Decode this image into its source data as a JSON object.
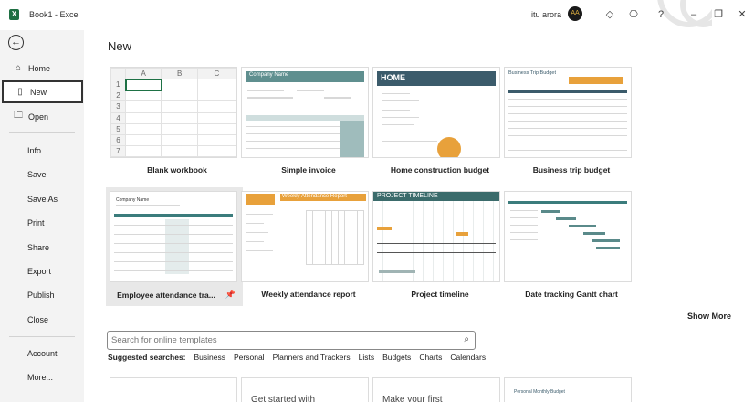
{
  "window": {
    "title": "Book1  -  Excel",
    "user_name": "itu arora",
    "avatar_initials": "AA"
  },
  "sidebar": {
    "items": [
      {
        "label": "Home",
        "icon": "home-icon"
      },
      {
        "label": "New",
        "icon": "new-file-icon"
      },
      {
        "label": "Open",
        "icon": "folder-open-icon"
      },
      {
        "label": "Info"
      },
      {
        "label": "Save"
      },
      {
        "label": "Save As"
      },
      {
        "label": "Print"
      },
      {
        "label": "Share"
      },
      {
        "label": "Export"
      },
      {
        "label": "Publish"
      },
      {
        "label": "Close"
      },
      {
        "label": "Account"
      },
      {
        "label": "More..."
      }
    ],
    "selected": "New"
  },
  "main": {
    "heading": "New",
    "templates_row1": [
      {
        "label": "Blank workbook"
      },
      {
        "label": "Simple invoice",
        "thumb_title": "Company Name"
      },
      {
        "label": "Home construction budget",
        "thumb_title": "HOME"
      },
      {
        "label": "Business trip budget",
        "thumb_title": "Business Trip Budget"
      }
    ],
    "templates_row2": [
      {
        "label": "Employee attendance tra...",
        "thumb_title": "Company Name"
      },
      {
        "label": "Weekly attendance report",
        "thumb_title": "Weekly Attendance Report"
      },
      {
        "label": "Project timeline",
        "thumb_title": "PROJECT TIMELINE"
      },
      {
        "label": "Date tracking Gantt chart"
      }
    ],
    "blank_grid": {
      "columns": [
        "A",
        "B",
        "C"
      ],
      "rows": [
        "1",
        "2",
        "3",
        "4",
        "5",
        "6",
        "7"
      ]
    },
    "show_more": "Show More",
    "search": {
      "placeholder": "Search for online templates"
    },
    "suggested": {
      "lead": "Suggested searches:",
      "links": [
        "Business",
        "Personal",
        "Planners and Trackers",
        "Lists",
        "Budgets",
        "Charts",
        "Calendars"
      ]
    },
    "bottom_cards": [
      "Get started with",
      "Make your first",
      "Personal Monthly Budget"
    ]
  },
  "colors": {
    "excel_green": "#1d6f42",
    "teal": "#3b7c7c",
    "orange": "#e8a13b"
  }
}
